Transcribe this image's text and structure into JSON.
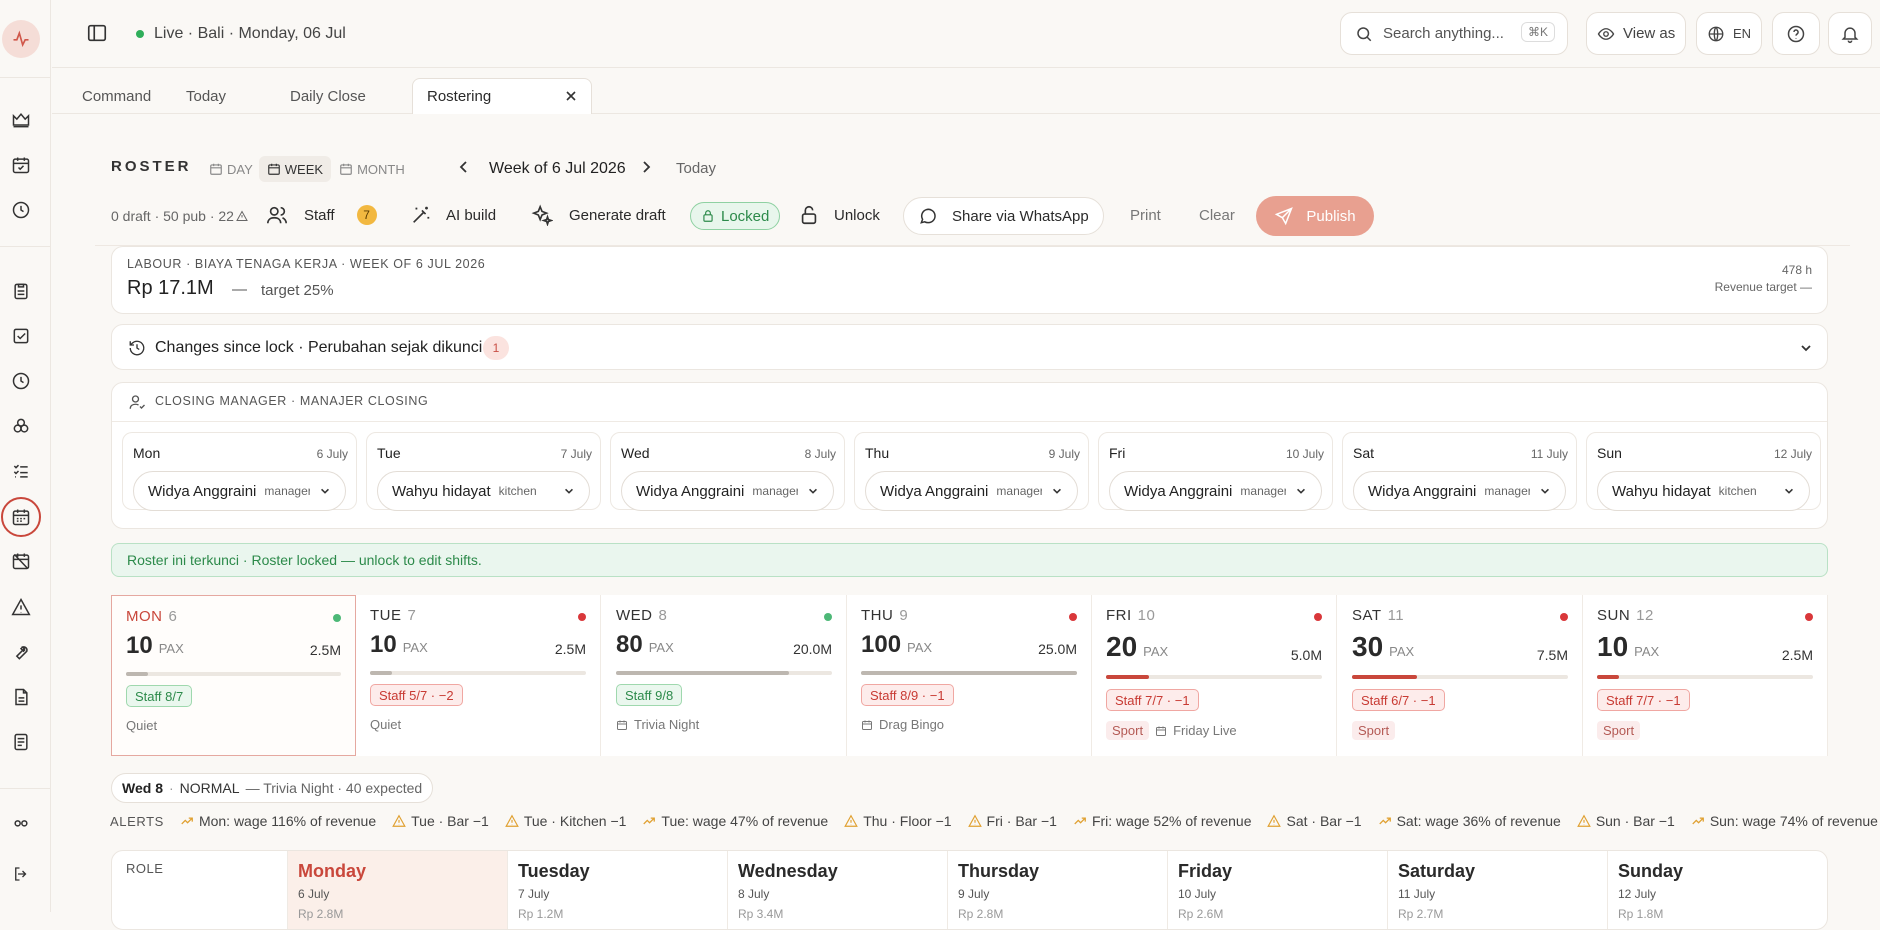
{
  "colors": {
    "accent": "#c9473b",
    "publish": "#e8a090",
    "green": "#2c8a4a",
    "red": "#d9373a"
  },
  "topbar": {
    "status": "Live · Bali · Monday, 06 Jul",
    "search_placeholder": "Search anything...",
    "search_shortcut": "⌘K",
    "view_as": "View as",
    "lang": "EN"
  },
  "tabs": [
    {
      "label": "Command"
    },
    {
      "label": "Today"
    },
    {
      "label": "Daily Close"
    },
    {
      "label": "Rostering"
    }
  ],
  "roster": {
    "title": "ROSTER",
    "mode_day": "DAY",
    "mode_week": "WEEK",
    "mode_month": "MONTH",
    "active_mode": "WEEK",
    "week_label": "Week of 6 Jul 2026",
    "today": "Today",
    "draft_stats": "0 draft · 50 pub · 22",
    "staff_label": "Staff",
    "staff_count": "7",
    "ai_build": "AI build",
    "generate_draft": "Generate draft",
    "locked": "Locked",
    "unlock": "Unlock",
    "share": "Share via WhatsApp",
    "print": "Print",
    "clear": "Clear",
    "publish": "Publish"
  },
  "labour": {
    "heading": "LABOUR · BIAYA TENAGA KERJA · WEEK OF 6 JUL 2026",
    "amount": "Rp 17.1M",
    "dash": "—",
    "target": "target 25%",
    "hours": "478 h",
    "revenue_target": "Revenue target —"
  },
  "changes": {
    "label": "Changes since lock · Perubahan sejak dikunci",
    "count": "1"
  },
  "closing": {
    "heading": "CLOSING MANAGER · MANAJER CLOSING",
    "days": [
      {
        "day": "Mon",
        "date": "6 July",
        "name": "Widya Anggraini",
        "role": "manager"
      },
      {
        "day": "Tue",
        "date": "7 July",
        "name": "Wahyu hidayat",
        "role": "kitchen"
      },
      {
        "day": "Wed",
        "date": "8 July",
        "name": "Widya Anggraini",
        "role": "manager"
      },
      {
        "day": "Thu",
        "date": "9 July",
        "name": "Widya Anggraini",
        "role": "manager"
      },
      {
        "day": "Fri",
        "date": "10 July",
        "name": "Widya Anggraini",
        "role": "manager"
      },
      {
        "day": "Sat",
        "date": "11 July",
        "name": "Widya Anggraini",
        "role": "manager"
      },
      {
        "day": "Sun",
        "date": "12 July",
        "name": "Wahyu hidayat",
        "role": "kitchen"
      }
    ]
  },
  "lock_banner": "Roster ini terkunci · Roster locked — unlock to edit shifts.",
  "week": [
    {
      "day": "MON",
      "num": "6",
      "pax": "10",
      "pax_label": "PAX",
      "revenue": "2.5M",
      "load": 0.1,
      "staff": "Staff 8/7",
      "staff_ok": true,
      "dot": "green",
      "note": "Quiet",
      "event": "",
      "sport": ""
    },
    {
      "day": "TUE",
      "num": "7",
      "pax": "10",
      "pax_label": "PAX",
      "revenue": "2.5M",
      "load": 0.1,
      "staff": "Staff 5/7 · −2",
      "staff_ok": false,
      "dot": "red",
      "note": "Quiet",
      "event": "",
      "sport": ""
    },
    {
      "day": "WED",
      "num": "8",
      "pax": "80",
      "pax_label": "PAX",
      "revenue": "20.0M",
      "load": 0.8,
      "staff": "Staff 9/8",
      "staff_ok": true,
      "dot": "green",
      "note": "",
      "event": "Trivia Night",
      "sport": ""
    },
    {
      "day": "THU",
      "num": "9",
      "pax": "100",
      "pax_label": "PAX",
      "revenue": "25.0M",
      "load": 1.0,
      "staff": "Staff 8/9 · −1",
      "staff_ok": false,
      "dot": "red",
      "note": "",
      "event": "Drag Bingo",
      "sport": ""
    },
    {
      "day": "FRI",
      "num": "10",
      "pax": "20",
      "pax_label": "PAX",
      "revenue": "5.0M",
      "load": 0.2,
      "staff": "Staff 7/7 · −1",
      "staff_ok": false,
      "dot": "red",
      "note": "",
      "event": "Friday Live",
      "sport": "Sport"
    },
    {
      "day": "SAT",
      "num": "11",
      "pax": "30",
      "pax_label": "PAX",
      "revenue": "7.5M",
      "load": 0.3,
      "staff": "Staff 6/7 · −1",
      "staff_ok": false,
      "dot": "red",
      "note": "",
      "event": "",
      "sport": "Sport"
    },
    {
      "day": "SUN",
      "num": "12",
      "pax": "10",
      "pax_label": "PAX",
      "revenue": "2.5M",
      "load": 0.1,
      "staff": "Staff 7/7 · −1",
      "staff_ok": false,
      "dot": "red",
      "note": "",
      "event": "",
      "sport": "Sport"
    }
  ],
  "selected_info": {
    "day": "Wed 8",
    "level": "NORMAL",
    "desc": "— Trivia Night · 40 expected"
  },
  "alerts": {
    "label": "ALERTS",
    "items": [
      {
        "type": "trend",
        "text": "Mon: wage 116% of revenue"
      },
      {
        "type": "warn",
        "text": "Tue · Bar −1"
      },
      {
        "type": "warn",
        "text": "Tue · Kitchen −1"
      },
      {
        "type": "trend",
        "text": "Tue: wage 47% of revenue"
      },
      {
        "type": "warn",
        "text": "Thu · Floor −1"
      },
      {
        "type": "warn",
        "text": "Fri · Bar −1"
      },
      {
        "type": "trend",
        "text": "Fri: wage 52% of revenue"
      },
      {
        "type": "warn",
        "text": "Sat · Bar −1"
      },
      {
        "type": "trend",
        "text": "Sat: wage 36% of revenue"
      },
      {
        "type": "warn",
        "text": "Sun · Bar −1"
      },
      {
        "type": "trend",
        "text": "Sun: wage 74% of revenue"
      }
    ]
  },
  "grid": {
    "role_header": "ROLE",
    "days": [
      {
        "name": "Monday",
        "date": "6 July",
        "rev": "Rp 2.8M"
      },
      {
        "name": "Tuesday",
        "date": "7 July",
        "rev": "Rp 1.2M"
      },
      {
        "name": "Wednesday",
        "date": "8 July",
        "rev": "Rp 3.4M"
      },
      {
        "name": "Thursday",
        "date": "9 July",
        "rev": "Rp 2.8M"
      },
      {
        "name": "Friday",
        "date": "10 July",
        "rev": "Rp 2.6M"
      },
      {
        "name": "Saturday",
        "date": "11 July",
        "rev": "Rp 2.7M"
      },
      {
        "name": "Sunday",
        "date": "12 July",
        "rev": "Rp 1.8M"
      }
    ]
  }
}
